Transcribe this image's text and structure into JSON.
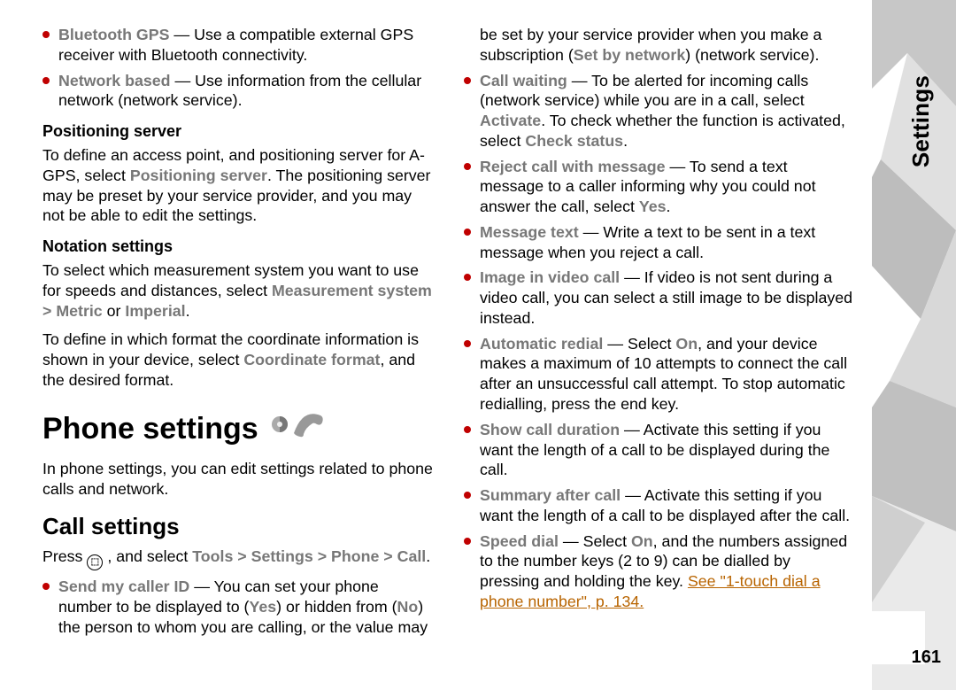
{
  "side_title": "Settings",
  "page_number": "161",
  "col1": {
    "bullets_top": [
      {
        "bold": "Bluetooth GPS",
        "text": " — Use a compatible external GPS receiver with Bluetooth connectivity."
      },
      {
        "bold": "Network based ",
        "text": " — Use information from the cellular network (network service)."
      }
    ],
    "pos_server_heading": "Positioning server",
    "pos_server_p1a": "To define an access point, and positioning server for A-GPS, select ",
    "pos_server_bold": "Positioning server",
    "pos_server_p1b": ". The positioning server may be preset by your service provider, and you may not be able to edit the settings.",
    "notation_heading": "Notation settings",
    "notation_p1a": "To select which measurement system you want to use for speeds and distances, select ",
    "notation_b1": "Measurement system",
    "notation_gt1": " > ",
    "notation_b2": "Metric",
    "notation_or": " or ",
    "notation_b3": "Imperial",
    "notation_p1end": ".",
    "notation_p2a": "To define in which format the coordinate information is shown in your device, select ",
    "notation_b4": "Coordinate format",
    "notation_p2b": ", and the desired format.",
    "phone_heading": "Phone settings",
    "phone_intro": "In phone settings, you can edit settings related to phone calls and network.",
    "call_heading": "Call settings",
    "call_press": "Press ",
    "call_select": " , and select ",
    "call_tools": "Tools",
    "call_gt": " > ",
    "call_settings": "Settings",
    "call_phone": "Phone",
    "call_call": "Call",
    "call_end": ".",
    "send_bold": "Send my caller ID ",
    "send_text_a": " — You can set your phone number to be displayed to (",
    "send_yes": "Yes",
    "send_text_b": ") or hidden from"
  },
  "col2": {
    "cont_a": "(",
    "cont_no": "No",
    "cont_b": ") the person to whom you are calling, or the value may be set by your service provider when you make a subscription (",
    "cont_set": "Set by network",
    "cont_c": ") (network service).",
    "items": [
      {
        "bold": "Call waiting ",
        "runs": [
          {
            "t": " — To be alerted for incoming calls (network service) while you are in a call, select "
          },
          {
            "t": "Activate",
            "b": true
          },
          {
            "t": ". To check whether the function is activated, select "
          },
          {
            "t": "Check status",
            "b": true
          },
          {
            "t": "."
          }
        ]
      },
      {
        "bold": "Reject call with message ",
        "runs": [
          {
            "t": " — To send a text message to a caller informing why you could not answer the call, select "
          },
          {
            "t": "Yes",
            "b": true
          },
          {
            "t": "."
          }
        ]
      },
      {
        "bold": "Message text ",
        "runs": [
          {
            "t": " — Write a text to be sent in a text message when you reject a call."
          }
        ]
      },
      {
        "bold": "Image in video call ",
        "runs": [
          {
            "t": " — If video is not sent during a video call, you can select a still image to be displayed instead."
          }
        ]
      },
      {
        "bold": "Automatic redial ",
        "runs": [
          {
            "t": " — Select "
          },
          {
            "t": "On",
            "b": true
          },
          {
            "t": ", and your device makes a maximum of 10 attempts to connect the call after an unsuccessful call attempt. To stop automatic redialling, press the end key."
          }
        ]
      },
      {
        "bold": "Show call duration ",
        "runs": [
          {
            "t": " — Activate this setting if you want the length of a call to be displayed during the call."
          }
        ]
      },
      {
        "bold": "Summary after call ",
        "runs": [
          {
            "t": " — Activate this setting if you want the length of a call to be displayed after the call."
          }
        ]
      },
      {
        "bold": "Speed dial ",
        "runs": [
          {
            "t": " — Select "
          },
          {
            "t": "On",
            "b": true
          },
          {
            "t": ", and the numbers assigned to the number keys (2 to 9) can be dialled by pressing and holding the key. "
          }
        ],
        "link": "See \"1-touch dial a phone number\", p. 134."
      }
    ]
  }
}
